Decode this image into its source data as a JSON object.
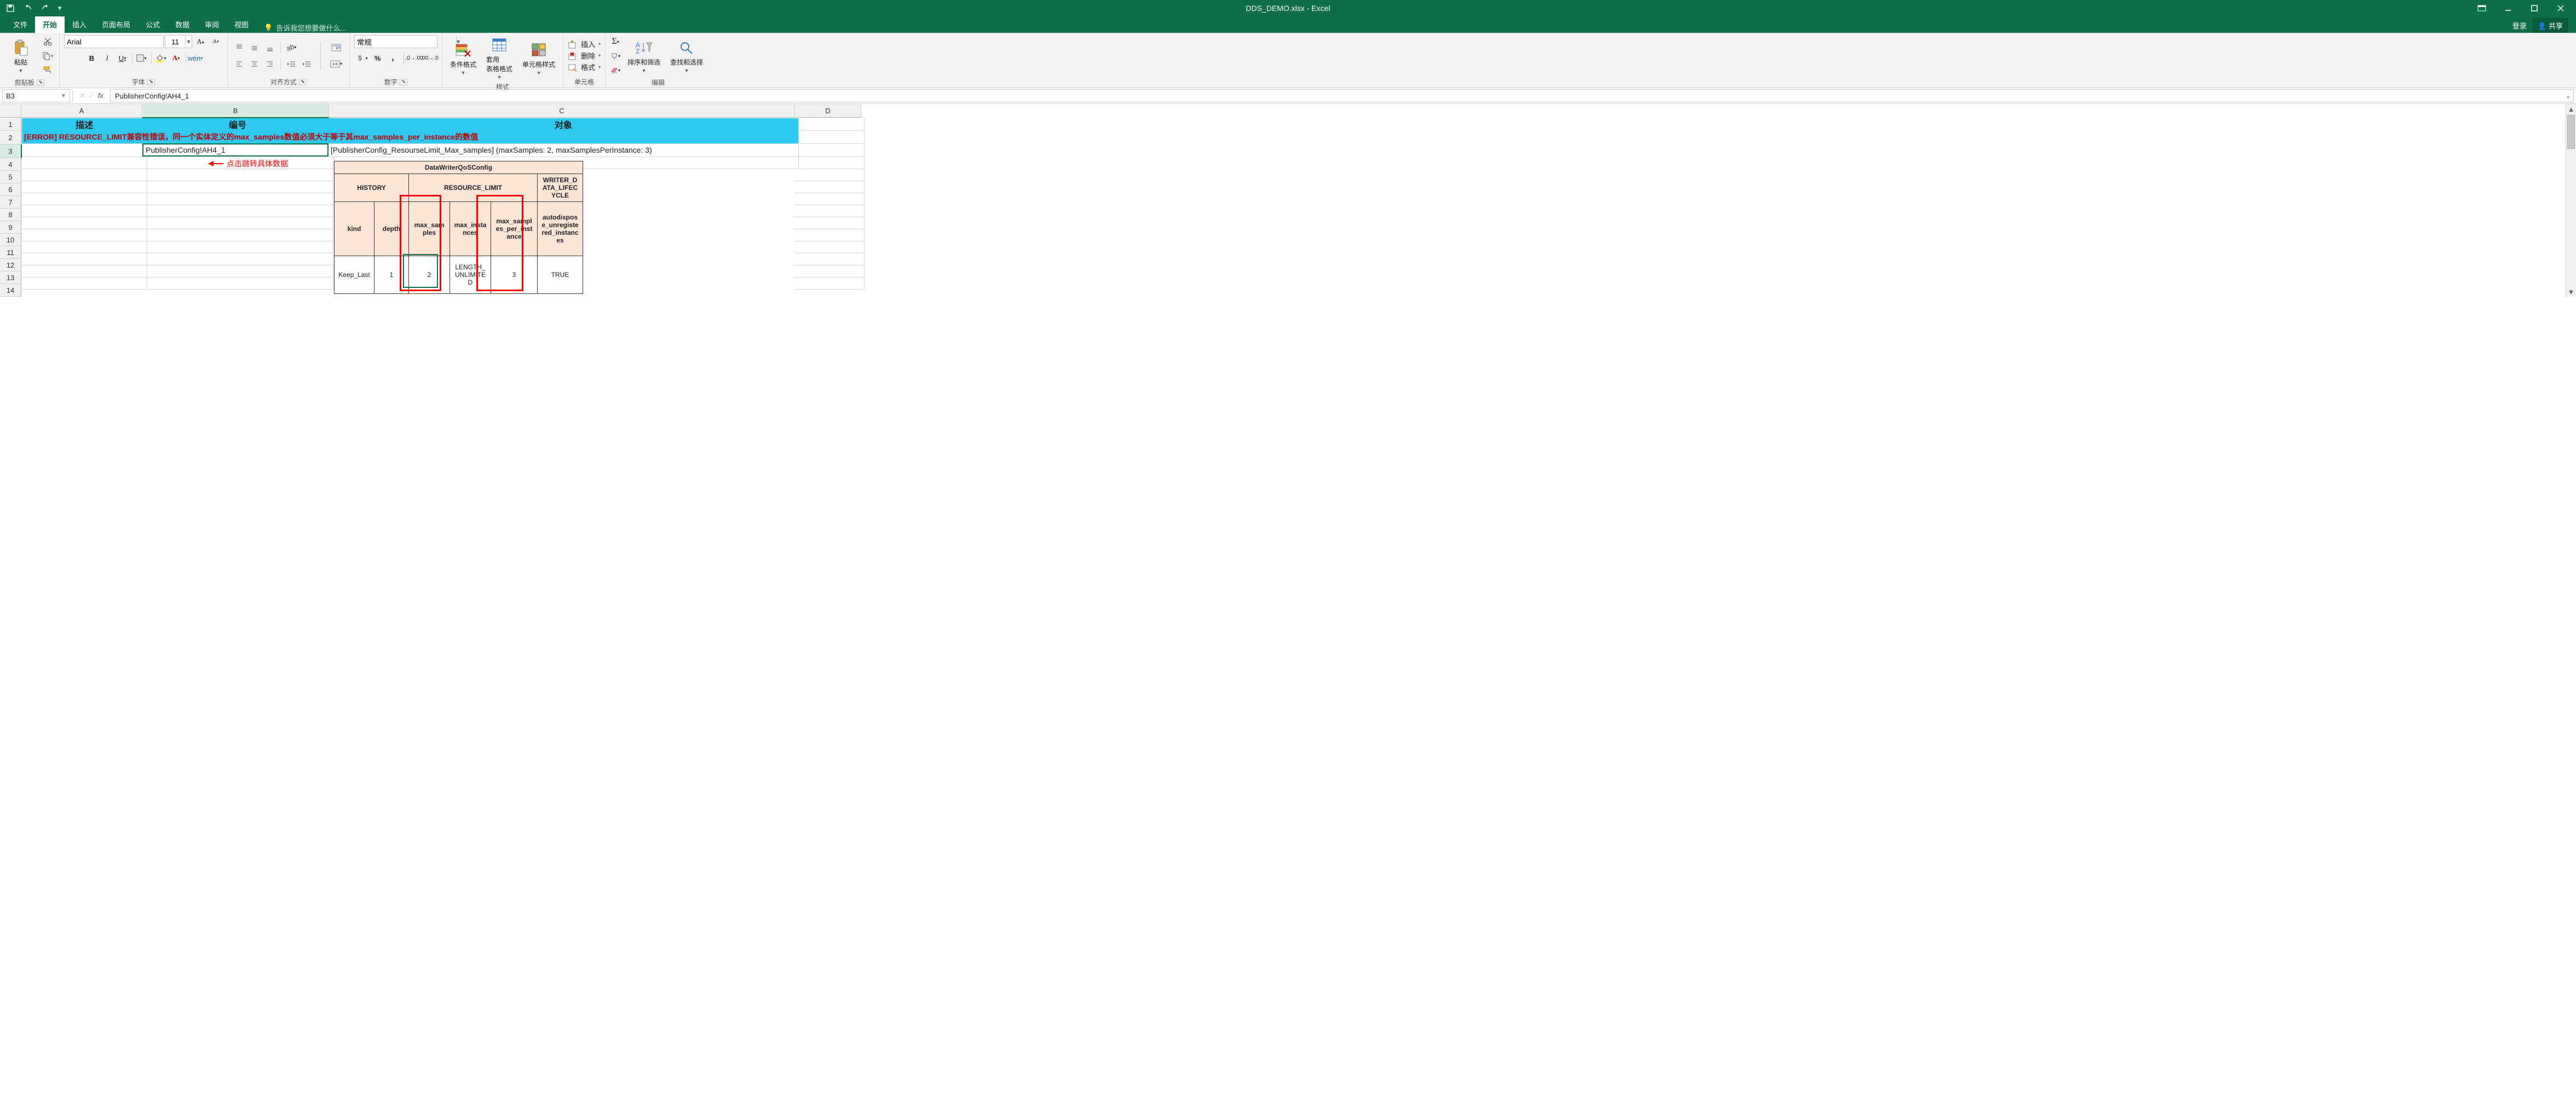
{
  "window": {
    "title": "DDS_DEMO.xlsx - Excel"
  },
  "ribbon": {
    "tabs": [
      "文件",
      "开始",
      "插入",
      "页面布局",
      "公式",
      "数据",
      "审阅",
      "视图"
    ],
    "active_tab": "开始",
    "tell_me": "告诉我您想要做什么...",
    "login": "登录",
    "share": "共享"
  },
  "clipboard": {
    "paste": "粘贴",
    "group": "剪贴板"
  },
  "font": {
    "name": "Arial",
    "size": "11",
    "bold": "B",
    "italic": "I",
    "underline": "U",
    "phonetic": "wén",
    "group": "字体"
  },
  "alignment": {
    "group": "对齐方式"
  },
  "number": {
    "format": "常规",
    "group": "数字"
  },
  "styles": {
    "conditional": "条件格式",
    "table": "套用\n表格格式",
    "cell": "单元格样式",
    "group": "样式"
  },
  "cells": {
    "insert": "插入",
    "delete": "删除",
    "format": "格式",
    "group": "单元格"
  },
  "editing": {
    "sort": "排序和筛选",
    "find": "查找和选择",
    "group": "编辑"
  },
  "formula": {
    "name_box": "B3",
    "bar": "PublisherConfig!AH4_1"
  },
  "columns": {
    "A": "A",
    "B": "B",
    "C": "C",
    "D": "D"
  },
  "col_widths": {
    "A": 220,
    "B": 340,
    "C": 850,
    "D": 120
  },
  "row_heights": {
    "h1": 22,
    "h2": 24,
    "h3": 24,
    "rest": 22
  },
  "headers": {
    "A": "描述",
    "B": "编号",
    "C": "对象"
  },
  "row2_error": "[ERROR] RESOURCE_LIMIT兼容性错误，同一个实体定义的max_samples数值必须大于等于其max_samples_per_instance的数值",
  "row3": {
    "B": "PublisherConfig!AH4_1",
    "C": "[PublisherConfig_ResourseLimit_Max_samples]  (maxSamples: 2, maxSamplesPerInstance: 3)"
  },
  "annotation": "点击跳转具体数据",
  "qos": {
    "title": "DataWriterQoSConfig",
    "groups": {
      "history": "HISTORY",
      "resource": "RESOURCE_LIMIT",
      "writer": "WRITER_DATA_LIFECYCLE"
    },
    "cols": {
      "kind": "kind",
      "depth": "depth",
      "max_samples": "max_samples",
      "max_instances": "max_instances",
      "max_spi": "max_samples_per_instance",
      "autodispose": "autodispose_unregistered_instances"
    },
    "data": {
      "kind": "Keep_Last",
      "depth": "1",
      "max_samples": "2",
      "max_instances": "LENGTH_UNLIMITED",
      "max_spi": "3",
      "autodispose": "TRUE"
    }
  }
}
